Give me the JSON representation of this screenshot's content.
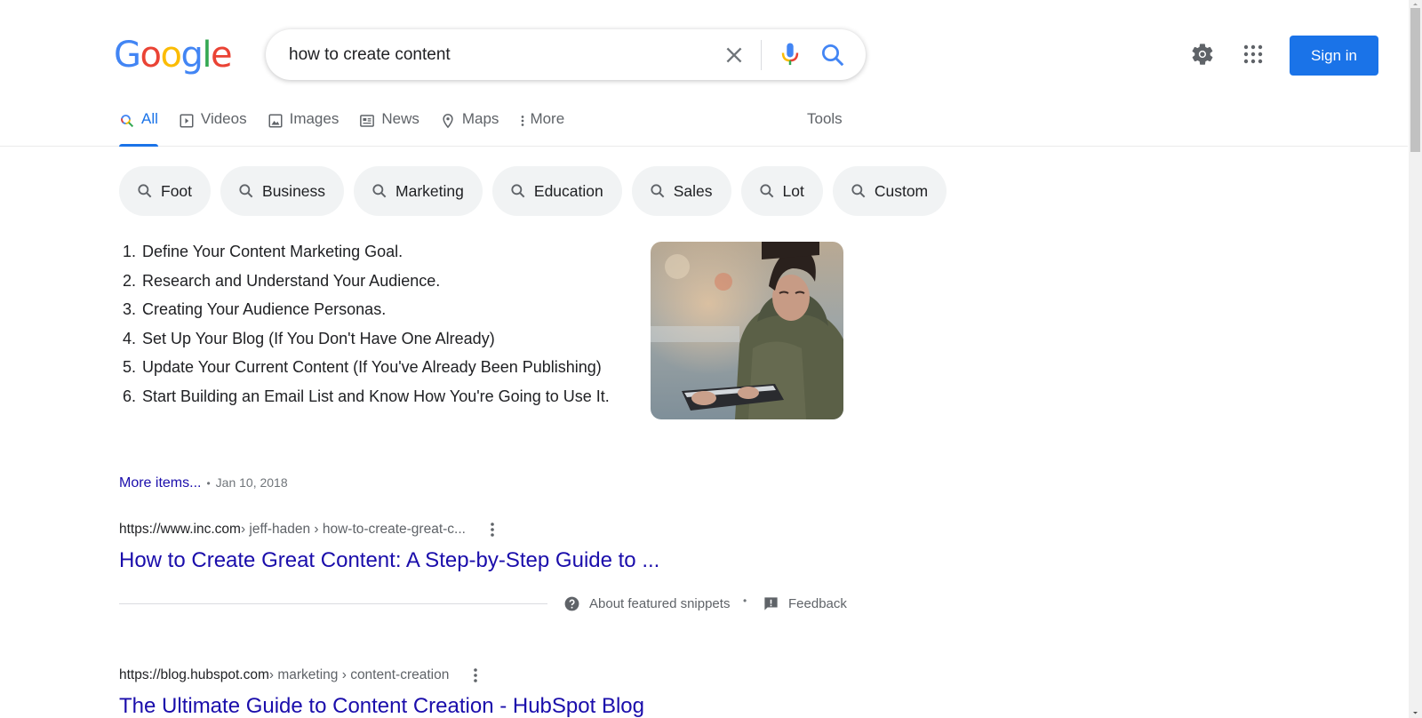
{
  "header": {
    "logo_letters": [
      {
        "ch": "G",
        "color": "#4285f4"
      },
      {
        "ch": "o",
        "color": "#ea4335"
      },
      {
        "ch": "o",
        "color": "#fbbc05"
      },
      {
        "ch": "g",
        "color": "#4285f4"
      },
      {
        "ch": "l",
        "color": "#34a853"
      },
      {
        "ch": "e",
        "color": "#ea4335"
      }
    ],
    "search_value": "how to create content",
    "sign_in_label": "Sign in"
  },
  "tabs": [
    {
      "label": "All",
      "icon": "search-icon",
      "active": true
    },
    {
      "label": "Videos",
      "icon": "video-icon",
      "active": false
    },
    {
      "label": "Images",
      "icon": "image-icon",
      "active": false
    },
    {
      "label": "News",
      "icon": "news-icon",
      "active": false
    },
    {
      "label": "Maps",
      "icon": "map-pin-icon",
      "active": false
    },
    {
      "label": "More",
      "icon": "more-vertical-icon",
      "active": false
    }
  ],
  "tools_label": "Tools",
  "chips": [
    "Foot",
    "Business",
    "Marketing",
    "Education",
    "Sales",
    "Lot",
    "Custom"
  ],
  "snippet": {
    "items": [
      {
        "num": "1.",
        "text": "Define Your Content Marketing Goal."
      },
      {
        "num": "2.",
        "text": "Research and Understand Your Audience."
      },
      {
        "num": "3.",
        "text": "Creating Your Audience Personas."
      },
      {
        "num": "4.",
        "text": "Set Up Your Blog (If You Don't Have One Already)"
      },
      {
        "num": "5.",
        "text": "Update Your Current Content (If You've Already Been Publishing)"
      },
      {
        "num": "6.",
        "text": "Start Building an Email List and Know How You're Going to Use It."
      }
    ],
    "image_alt": "Woman reading a tablet",
    "more_items_label": "More items...",
    "date": "Jan 10, 2018",
    "about_label": "About featured snippets",
    "feedback_label": "Feedback"
  },
  "results": [
    {
      "url_host": "https://www.inc.com",
      "url_crumbs": " › jeff-haden › how-to-create-great-c...",
      "title": "How to Create Great Content: A Step-by-Step Guide to ..."
    },
    {
      "url_host": "https://blog.hubspot.com",
      "url_crumbs": " › marketing › content-creation",
      "title": "The Ultimate Guide to Content Creation - HubSpot Blog"
    }
  ],
  "colors": {
    "accent": "#1a73e8",
    "link": "#1a0dab",
    "chip_bg": "#f1f3f4",
    "muted": "#5f6368"
  }
}
